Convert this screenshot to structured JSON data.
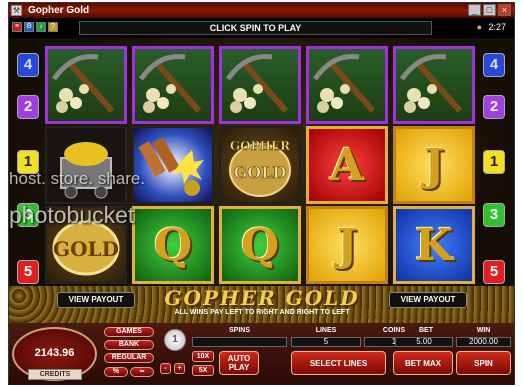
{
  "window": {
    "title": "Gopher Gold",
    "clock": "2:27",
    "controls": [
      "minimize",
      "maximize",
      "close"
    ]
  },
  "toolbar": {
    "icons": [
      "menu-icon",
      "options-icon",
      "sound-icon",
      "help-icon"
    ]
  },
  "message": "CLICK SPIN TO PLAY",
  "paylines_left": [
    "4",
    "2",
    "1",
    "3",
    "5"
  ],
  "paylines_right": [
    "4",
    "2",
    "1",
    "3",
    "5"
  ],
  "reels": {
    "row1": [
      "pickaxe-gold-nuggets",
      "pickaxe-gold-nuggets",
      "pickaxe-gold-nuggets",
      "pickaxe-gold-nuggets",
      "pickaxe-gold-nuggets"
    ],
    "row2": [
      "mine-cart",
      "dynamite",
      "gopher-gold-logo",
      "A",
      "J"
    ],
    "row3": [
      "gold-coin",
      "Q",
      "Q",
      "J",
      "K"
    ]
  },
  "view_payout_left": "VIEW PAYOUT",
  "view_payout_right": "VIEW PAYOUT",
  "logo": "GOPHER GOLD",
  "wins_info": "ALL WINS PAY LEFT TO RIGHT AND RIGHT TO LEFT",
  "watermark": {
    "line1": "host. store. share.",
    "line2": "photobucket"
  },
  "panel": {
    "credits_value": "2143.96",
    "credits_label": "CREDITS",
    "side_buttons": [
      "GAMES",
      "BANK",
      "REGULAR",
      "%"
    ],
    "coin_size": "1",
    "minus": "-",
    "plus": "+",
    "x10": "10X",
    "x5": "5X",
    "spins_label": "SPINS",
    "spins_value": "",
    "lines_label": "LINES",
    "lines_value": "5",
    "coins_label": "COINS",
    "coins_value": "1",
    "bet_label": "BET",
    "bet_value": "5.00",
    "win_label": "WIN",
    "win_value": "2000.00",
    "autoplay": "AUTO PLAY",
    "select_lines": "SELECT LINES",
    "bet_max": "BET MAX",
    "spin": "SPIN"
  }
}
